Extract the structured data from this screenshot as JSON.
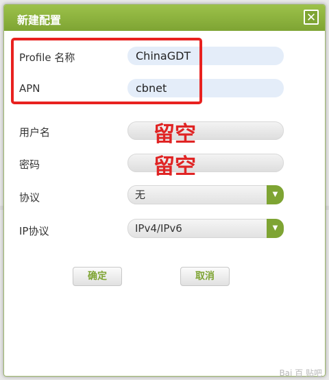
{
  "dialog": {
    "title": "新建配置",
    "close_symbol": "✕"
  },
  "fields": {
    "profile_name": {
      "label": "Profile 名称",
      "value": "ChinaGDT"
    },
    "apn": {
      "label": "APN",
      "value": "cbnet"
    },
    "username": {
      "label": "用户名",
      "value": "",
      "annotation": "留空"
    },
    "password": {
      "label": "密码",
      "value": "",
      "annotation": "留空"
    },
    "protocol": {
      "label": "协议",
      "selected": "无"
    },
    "ip_protocol": {
      "label": "IP协议",
      "selected": "IPv4/IPv6"
    }
  },
  "buttons": {
    "confirm": "确定",
    "cancel": "取消"
  },
  "watermark": "Bai 百 贴吧",
  "colors": {
    "accent": "#7ea433",
    "annotation": "#e02424"
  },
  "icons": {
    "close": "close-icon",
    "dropdown": "chevron-down-icon"
  }
}
